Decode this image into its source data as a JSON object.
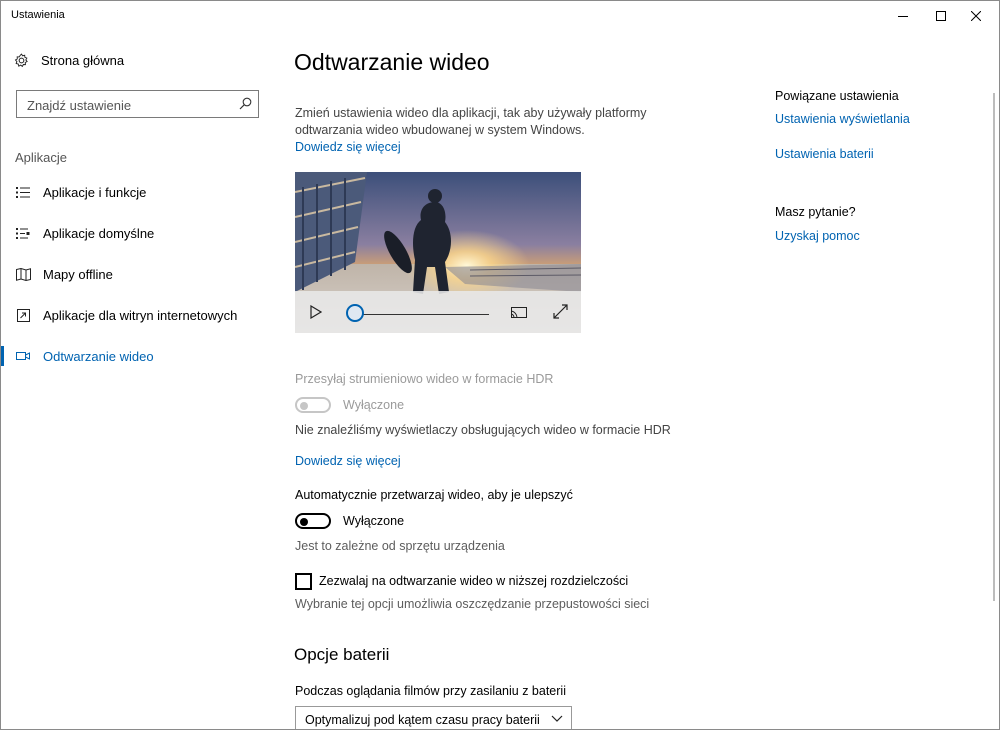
{
  "window": {
    "title": "Ustawienia"
  },
  "sidebar": {
    "home_label": "Strona główna",
    "search_placeholder": "Znajdź ustawienie",
    "section_label": "Aplikacje",
    "items": [
      {
        "label": "Aplikacje i funkcje",
        "icon": "apps-features-icon",
        "active": false
      },
      {
        "label": "Aplikacje domyślne",
        "icon": "default-apps-icon",
        "active": false
      },
      {
        "label": "Mapy offline",
        "icon": "offline-maps-icon",
        "active": false
      },
      {
        "label": "Aplikacje dla witryn internetowych",
        "icon": "apps-for-websites-icon",
        "active": false
      },
      {
        "label": "Odtwarzanie wideo",
        "icon": "video-playback-icon",
        "active": true
      }
    ]
  },
  "main": {
    "title": "Odtwarzanie wideo",
    "description": "Zmień ustawienia wideo dla aplikacji, tak aby używały platformy odtwarzania wideo wbudowanej w system Windows.",
    "learn_more": "Dowiedz się więcej",
    "video_progress": 0,
    "hdr": {
      "label": "Przesyłaj strumieniowo wideo w formacie HDR",
      "state": "Wyłączone",
      "enabled": false,
      "note": "Nie znaleźliśmy wyświetlaczy obsługujących wideo w formacie HDR",
      "learn_more": "Dowiedz się więcej"
    },
    "auto_process": {
      "label": "Automatycznie przetwarzaj wideo, aby je ulepszyć",
      "state": "Wyłączone",
      "note": "Jest to zależne od sprzętu urządzenia"
    },
    "low_res": {
      "label": "Zezwalaj na odtwarzanie wideo w niższej rozdzielczości",
      "checked": false,
      "note": "Wybranie tej opcji umożliwia oszczędzanie przepustowości sieci"
    },
    "battery": {
      "heading": "Opcje baterii",
      "label": "Podczas oglądania filmów przy zasilaniu z baterii",
      "selected": "Optymalizuj pod kątem czasu pracy baterii"
    }
  },
  "related": {
    "heading": "Powiązane ustawienia",
    "links": [
      "Ustawienia wyświetlania",
      "Ustawienia baterii"
    ],
    "question_heading": "Masz pytanie?",
    "help_link": "Uzyskaj pomoc"
  },
  "colors": {
    "accent": "#0063b1",
    "disabled": "#9a9a9a",
    "secondary": "#5d5d5d"
  }
}
